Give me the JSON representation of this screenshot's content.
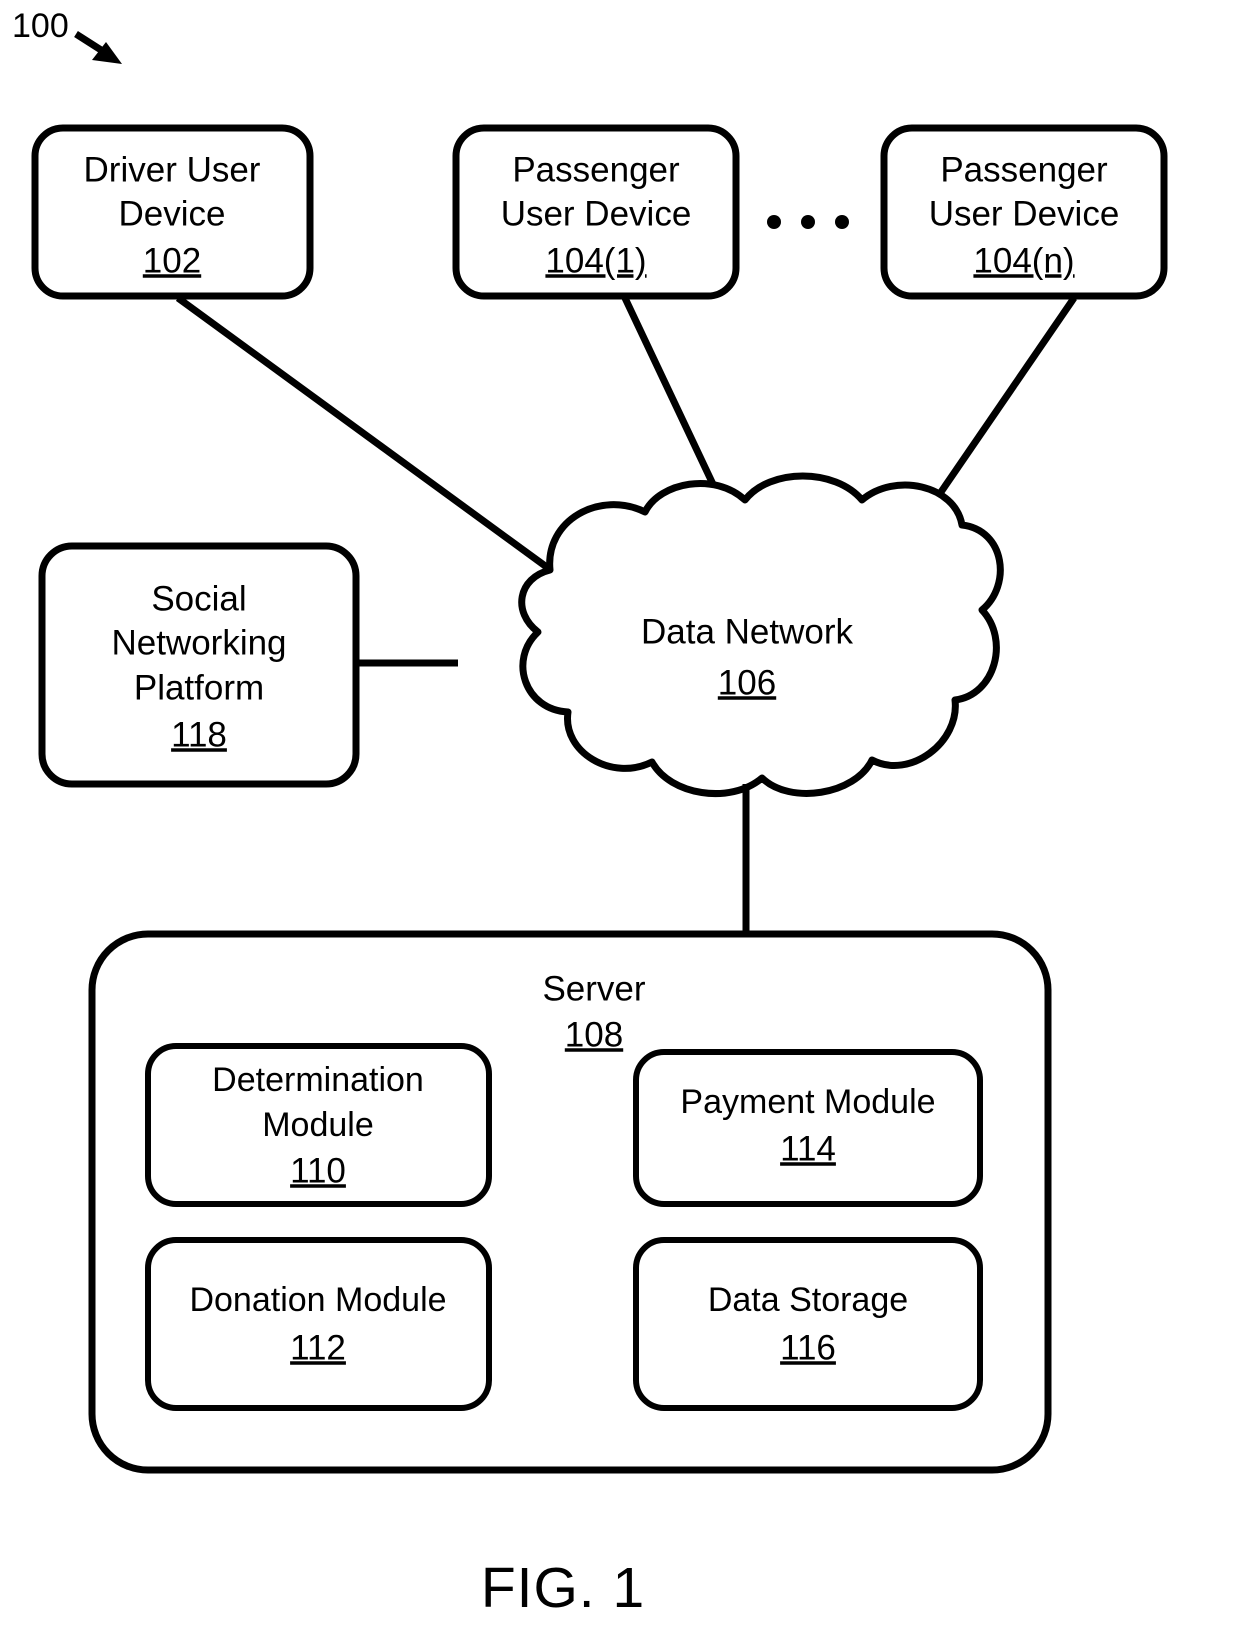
{
  "figure": {
    "caption": "FIG. 1",
    "system_label": "100"
  },
  "nodes": {
    "driver_device": {
      "line1": "Driver User",
      "line2": "Device",
      "ref": "102"
    },
    "passenger_device_1": {
      "line1": "Passenger",
      "line2": "User Device",
      "ref": "104(1)"
    },
    "passenger_device_n": {
      "line1": "Passenger",
      "line2": "User Device",
      "ref": "104(n)"
    },
    "ellipsis": "· · ·",
    "social_platform": {
      "line1": "Social",
      "line2": "Networking",
      "line3": "Platform",
      "ref": "118"
    },
    "data_network": {
      "line1": "Data Network",
      "ref": "106"
    },
    "server": {
      "line1": "Server",
      "ref": "108"
    },
    "determination_module": {
      "line1": "Determination",
      "line2": "Module",
      "ref": "110"
    },
    "donation_module": {
      "line1": "Donation Module",
      "ref": "112"
    },
    "payment_module": {
      "line1": "Payment Module",
      "ref": "114"
    },
    "data_storage": {
      "line1": "Data Storage",
      "ref": "116"
    }
  },
  "colors": {
    "stroke": "#000000",
    "fill": "#ffffff",
    "background": "#ffffff"
  }
}
